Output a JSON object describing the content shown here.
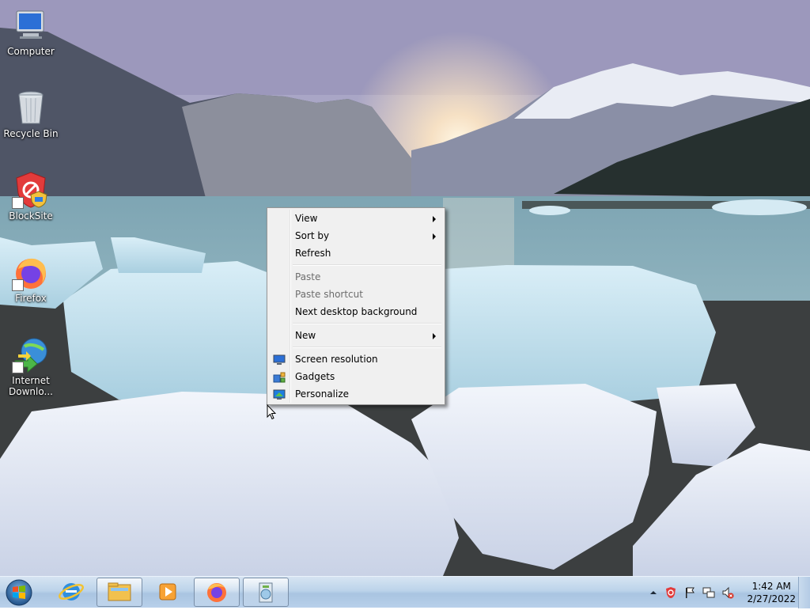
{
  "desktop": {
    "icons": [
      {
        "label": "Computer"
      },
      {
        "label": "Recycle Bin"
      },
      {
        "label": "BlockSite"
      },
      {
        "label": "Firefox"
      },
      {
        "label": "Internet Downlo..."
      }
    ]
  },
  "context_menu": {
    "items": [
      {
        "label": "View",
        "submenu": true
      },
      {
        "label": "Sort by",
        "submenu": true
      },
      {
        "label": "Refresh"
      },
      {
        "label": "Paste",
        "disabled": true
      },
      {
        "label": "Paste shortcut",
        "disabled": true
      },
      {
        "label": "Next desktop background"
      },
      {
        "label": "New",
        "submenu": true
      },
      {
        "label": "Screen resolution",
        "icon": "display-icon"
      },
      {
        "label": "Gadgets",
        "icon": "gadgets-icon"
      },
      {
        "label": "Personalize",
        "icon": "personalize-icon"
      }
    ]
  },
  "taskbar": {
    "pinned": [
      {
        "icon": "internet-explorer-icon"
      },
      {
        "icon": "windows-explorer-icon"
      },
      {
        "icon": "media-player-icon"
      },
      {
        "icon": "firefox-icon"
      },
      {
        "icon": "installer-icon"
      }
    ],
    "tray": {
      "icons": [
        "show-hidden-icons",
        "blocksite-tray-icon",
        "action-center-flag-icon",
        "network-icon",
        "volume-muted-icon"
      ]
    },
    "clock": {
      "time": "1:42 AM",
      "date": "2/27/2022"
    }
  },
  "colors": {
    "menu_bg": "#f0f0f0",
    "menu_border": "#979797",
    "disabled_text": "#6d6d6d",
    "taskbar": "#bcd3ea"
  }
}
